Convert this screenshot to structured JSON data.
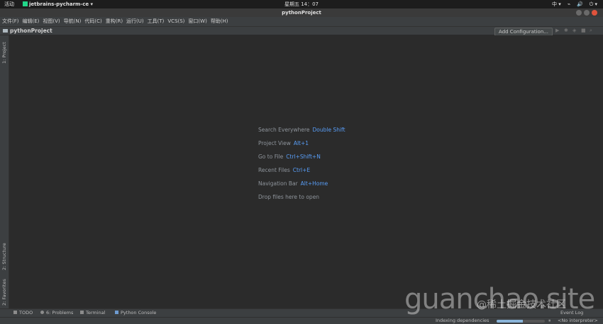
{
  "topbar": {
    "activities": "活动",
    "app_name": "jetbrains-pycharm-ce ▾",
    "clock": "星期五 14：07",
    "tray": [
      "中 ▾",
      "⌁",
      "🔊",
      "⏻ ▾"
    ]
  },
  "window": {
    "title": "pythonProject"
  },
  "menu": {
    "items": [
      "文件(F)",
      "编辑(E)",
      "视图(V)",
      "导航(N)",
      "代码(C)",
      "重构(R)",
      "运行(U)",
      "工具(T)",
      "VCS(S)",
      "窗口(W)",
      "帮助(H)"
    ]
  },
  "navbar": {
    "project": "pythonProject",
    "add_config": "Add Configuration..."
  },
  "side_tabs": {
    "project": "1: Project",
    "structure": "2: Structure",
    "favorites": "2: Favorites"
  },
  "hints": [
    {
      "label": "Search Everywhere",
      "key": "Double Shift"
    },
    {
      "label": "Project View",
      "key": "Alt+1"
    },
    {
      "label": "Go to File",
      "key": "Ctrl+Shift+N"
    },
    {
      "label": "Recent Files",
      "key": "Ctrl+E"
    },
    {
      "label": "Navigation Bar",
      "key": "Alt+Home"
    },
    {
      "label": "Drop files here to open",
      "key": ""
    }
  ],
  "bottom_tabs": {
    "todo": "TODO",
    "problems": "6: Problems",
    "terminal": "Terminal",
    "python_console": "Python Console",
    "event_log": "Event Log"
  },
  "status": {
    "indexing": "Indexing dependencies",
    "progress": 0.55,
    "interpreter": "<No interpreter>"
  },
  "watermark": {
    "text": "guanchao.site",
    "text2": "@稀土掘金技术社区"
  }
}
